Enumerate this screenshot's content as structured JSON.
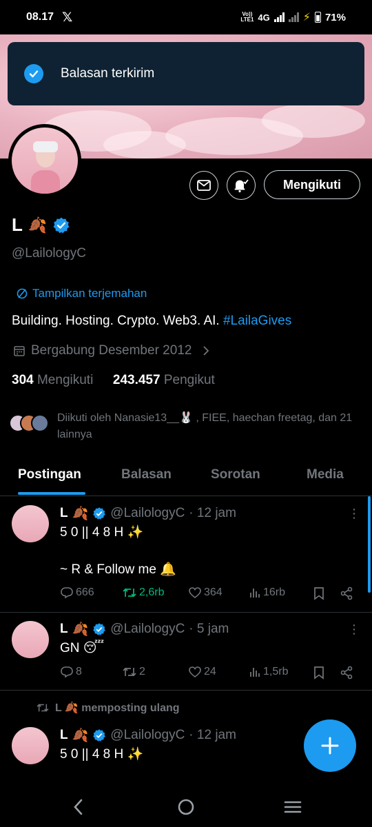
{
  "status_bar": {
    "time": "08.17",
    "x_logo": "𝕏",
    "network_small_top": "Vo))",
    "network_small_bottom": "LTE1",
    "network_type": "4G",
    "battery": "71%"
  },
  "toast": {
    "message": "Balasan terkirim"
  },
  "profile": {
    "name": "L",
    "name_emoji": "🍂",
    "handle": "@LailologyC",
    "translate_label": "Tampilkan terjemahan",
    "bio_text": "Building. Hosting. Crypto. Web3. AI. ",
    "bio_hashtag": "#LailaGives",
    "joined": "Bergabung Desember 2012",
    "following_count": "304",
    "following_label": "Mengikuti",
    "followers_count": "243.457",
    "followers_label": "Pengikut",
    "followed_by": "Diikuti oleh Nanasie13__🐰 , FIEE, haechan freetag, dan 21 lainnya",
    "follow_button": "Mengikuti"
  },
  "tabs": [
    "Postingan",
    "Balasan",
    "Sorotan",
    "Media"
  ],
  "posts": [
    {
      "name": "L",
      "emoji": "🍂",
      "handle": "@LailologyC",
      "time": "· 12 jam",
      "text": "5 0 || 4 8 H ✨\n\n~ R & Follow me 🔔",
      "replies": "666",
      "reposts": "2,6rb",
      "likes": "364",
      "views": "16rb"
    },
    {
      "name": "L",
      "emoji": "🍂",
      "handle": "@LailologyC",
      "time": "· 5 jam",
      "text": "GN 😴",
      "replies": "8",
      "reposts": "2",
      "likes": "24",
      "views": "1,5rb"
    },
    {
      "repost_label": "L 🍂 memposting ulang",
      "name": "L",
      "emoji": "🍂",
      "handle": "@LailologyC",
      "time": "· 12 jam",
      "text": "5 0 || 4 8 H ✨"
    }
  ],
  "colors": {
    "accent": "#1d9bf0",
    "repost_green": "#00ba7c",
    "toast_bg": "#0f2233",
    "muted": "#71767b"
  }
}
